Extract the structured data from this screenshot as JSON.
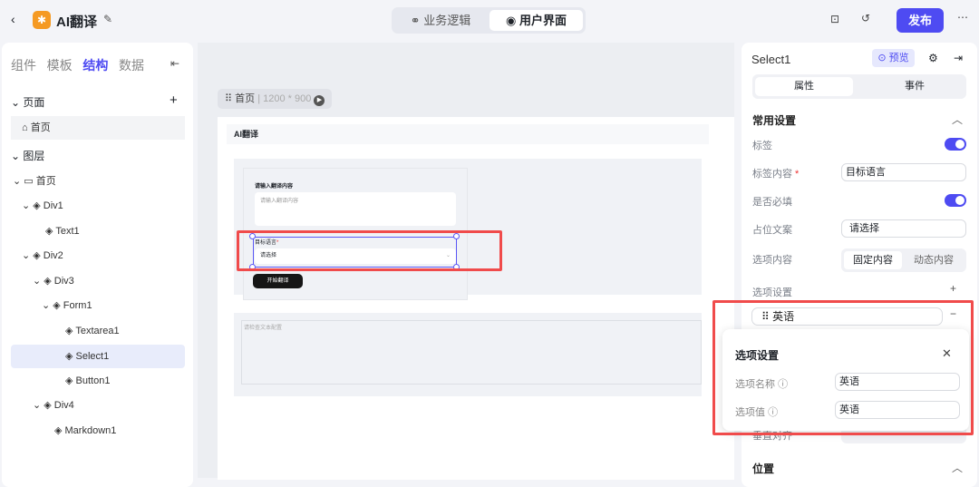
{
  "topbar": {
    "app_title": "AI翻译",
    "tabs": [
      {
        "label": "业务逻辑"
      },
      {
        "label": "用户界面"
      }
    ],
    "publish": "发布"
  },
  "left": {
    "tabs": [
      "组件",
      "模板",
      "结构",
      "数据"
    ],
    "pages_title": "页面",
    "page_item": "首页",
    "layers_title": "图层",
    "layers": [
      "首页",
      "Div1",
      "Text1",
      "Div2",
      "Div3",
      "Form1",
      "Textarea1",
      "Select1",
      "Button1",
      "Div4",
      "Markdown1"
    ]
  },
  "canvas": {
    "page_name": "首页",
    "page_size": "1200 * 900",
    "app_header": "AI翻译",
    "textarea_label": "请输入翻译内容",
    "textarea_placeholder": "请输入翻译内容",
    "select_label": "目标语言",
    "required_mark": "*",
    "select_placeholder": "请选择",
    "button": "开始翻译",
    "markdown_placeholder": "请检查文本配置"
  },
  "right": {
    "component": "Select1",
    "preview": "预览",
    "tabs": [
      "属性",
      "事件"
    ],
    "section": "常用设置",
    "label": "标签",
    "label_content": "标签内容",
    "label_value": "目标语言",
    "required": "是否必填",
    "placeholder": "占位文案",
    "placeholder_value": "请选择",
    "options_content": "选项内容",
    "options_modes": [
      "固定内容",
      "动态内容"
    ],
    "options_settings": "选项设置",
    "option_item": "英语",
    "vertical_align": "垂直对齐",
    "position": "位置"
  },
  "popup": {
    "title": "选项设置",
    "name_label": "选项名称",
    "name_value": "英语",
    "value_label": "选项值",
    "value_value": "英语"
  },
  "colors": {
    "accent": "#4e4bf2",
    "highlight": "#f04b4b"
  }
}
